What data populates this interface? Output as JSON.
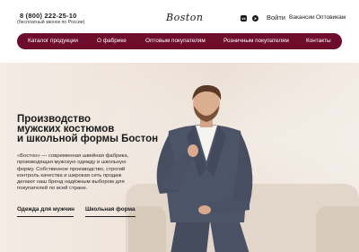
{
  "header": {
    "phone": "8 (800) 222-25-10",
    "phone_note": "(бесплатный звонок по России)",
    "logo": "Boston",
    "social": [
      "vk-icon",
      "telegram-icon"
    ],
    "login": "Войти",
    "links": [
      "Вакансии",
      "Оптовикам"
    ]
  },
  "nav": {
    "items": [
      "Каталог продукции",
      "О фабрике",
      "Оптовым покупателям",
      "Розничным покупателям",
      "Контакты"
    ]
  },
  "hero": {
    "title_lines": [
      "Производство",
      "мужских костюмов",
      "и школьной формы Бостон"
    ],
    "description_lines": [
      "«Бостон» — современная швейная фабрика,",
      "производящая мужскую одежду и школьную",
      "форму. Собственное производство, строгий",
      "контроль качества и широкая сеть продаж",
      "делают наш бренд надёжным выбором для",
      "покупателей по всей стране."
    ],
    "buttons": [
      "Одежда для мужчин",
      "Школьная форма"
    ]
  },
  "colors": {
    "accent": "#6e0c2c",
    "suit": "#4c5468",
    "background": "#efe5dc"
  }
}
